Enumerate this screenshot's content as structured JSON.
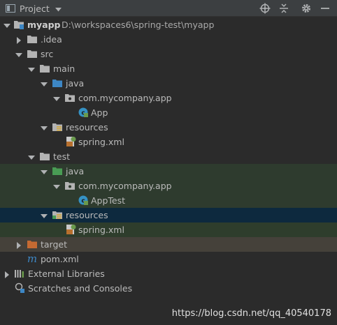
{
  "header": {
    "title": "Project",
    "icons": [
      "project-pane-icon",
      "dropdown-icon",
      "locate-icon",
      "collapse-icon",
      "gear-icon",
      "hide-icon"
    ]
  },
  "tree": {
    "root_label": "myapp",
    "root_path": "D:\\workspaces6\\spring-test\\myapp",
    "idea": ".idea",
    "src": "src",
    "main": "main",
    "main_java": "java",
    "main_pkg": "com.mycompany.app",
    "app": "App",
    "main_resources": "resources",
    "main_spring": "spring.xml",
    "test": "test",
    "test_java": "java",
    "test_pkg": "com.mycompany.app",
    "apptest": "AppTest",
    "test_resources": "resources",
    "test_spring": "spring.xml",
    "target": "target",
    "pom": "pom.xml",
    "external_libraries": "External Libraries",
    "scratches": "Scratches and Consoles"
  },
  "colors": {
    "folder": "#b3b3b3",
    "source_folder": "#3d87c5",
    "test_folder": "#499c54",
    "excluded_folder": "#c56a32",
    "class": "#3592c4"
  },
  "watermark": "https://blog.csdn.net/qq_40540178"
}
